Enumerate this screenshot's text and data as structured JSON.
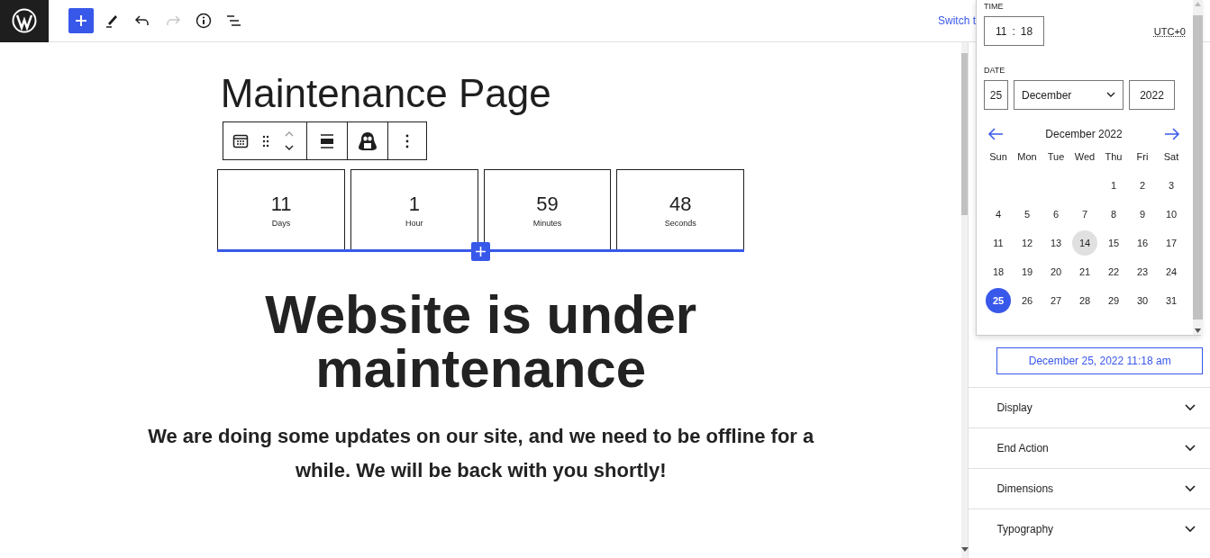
{
  "top_bar": {
    "switch_link": "Switch t"
  },
  "document": {
    "title": "Maintenance Page",
    "countdown": [
      {
        "value": "11",
        "label": "Days"
      },
      {
        "value": "1",
        "label": "Hour"
      },
      {
        "value": "59",
        "label": "Minutes"
      },
      {
        "value": "48",
        "label": "Seconds"
      }
    ],
    "heading": "Website is under maintenance",
    "paragraph": "We are doing some updates on our site, and we need to be offline for a while. We will be back with you shortly!"
  },
  "date_picker": {
    "time_label": "TIME",
    "hours": "11",
    "separator": ":",
    "minutes": "18",
    "timezone": "UTC+0",
    "date_label": "DATE",
    "day": "25",
    "month": "December",
    "year": "2022",
    "calendar_title": "December 2022",
    "weekdays": [
      "Sun",
      "Mon",
      "Tue",
      "Wed",
      "Thu",
      "Fri",
      "Sat"
    ],
    "weeks": [
      [
        {
          "day": "1",
          "today": false,
          "selected": false
        },
        {
          "day": "2",
          "today": false,
          "selected": false
        },
        {
          "day": "3",
          "today": false,
          "selected": false
        }
      ],
      [
        {
          "day": "4",
          "today": false,
          "selected": false
        },
        {
          "day": "5",
          "today": false,
          "selected": false
        },
        {
          "day": "6",
          "today": false,
          "selected": false
        },
        {
          "day": "7",
          "today": false,
          "selected": false
        },
        {
          "day": "8",
          "today": false,
          "selected": false
        },
        {
          "day": "9",
          "today": false,
          "selected": false
        },
        {
          "day": "10",
          "today": false,
          "selected": false
        }
      ],
      [
        {
          "day": "11",
          "today": false,
          "selected": false
        },
        {
          "day": "12",
          "today": false,
          "selected": false
        },
        {
          "day": "13",
          "today": false,
          "selected": false
        },
        {
          "day": "14",
          "today": true,
          "selected": false
        },
        {
          "day": "15",
          "today": false,
          "selected": false
        },
        {
          "day": "16",
          "today": false,
          "selected": false
        },
        {
          "day": "17",
          "today": false,
          "selected": false
        }
      ],
      [
        {
          "day": "18",
          "today": false,
          "selected": false
        },
        {
          "day": "19",
          "today": false,
          "selected": false
        },
        {
          "day": "20",
          "today": false,
          "selected": false
        },
        {
          "day": "21",
          "today": false,
          "selected": false
        },
        {
          "day": "22",
          "today": false,
          "selected": false
        },
        {
          "day": "23",
          "today": false,
          "selected": false
        },
        {
          "day": "24",
          "today": false,
          "selected": false
        }
      ],
      [
        {
          "day": "25",
          "today": false,
          "selected": true
        },
        {
          "day": "26",
          "today": false,
          "selected": false
        },
        {
          "day": "27",
          "today": false,
          "selected": false
        },
        {
          "day": "28",
          "today": false,
          "selected": false
        },
        {
          "day": "29",
          "today": false,
          "selected": false
        },
        {
          "day": "30",
          "today": false,
          "selected": false
        },
        {
          "day": "31",
          "today": false,
          "selected": false
        }
      ]
    ]
  },
  "sidebar": {
    "date_button": "December 25, 2022 11:18 am",
    "sections": [
      {
        "label": "Display",
        "expanded": false
      },
      {
        "label": "End Action",
        "expanded": false
      },
      {
        "label": "Dimensions",
        "expanded": false
      },
      {
        "label": "Typography",
        "expanded": false
      }
    ]
  }
}
